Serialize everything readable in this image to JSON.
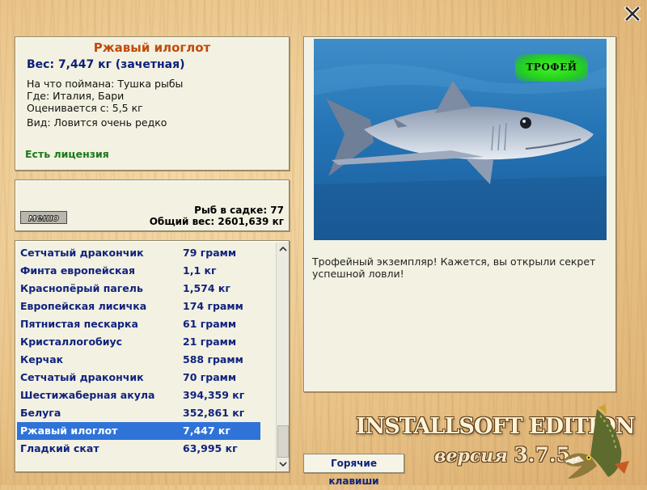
{
  "fish": {
    "name": "Ржавый илоглот",
    "weight": "Вес: 7,447 кг (зачетная)",
    "bait": "На что поймана: Тушка рыбы",
    "location": "Где: Италия, Бари",
    "value": "Оценивается с: 5,5 кг",
    "rarity": "Вид: Ловится очень редко",
    "license": "Есть лицензия"
  },
  "cage": {
    "menu_logo": "меню",
    "count": "Рыб в садке: 77",
    "total_weight": "Общий вес: 2601,639 кг"
  },
  "catch_list": [
    {
      "name": "Сетчатый дракончик",
      "weight": "79 грамм"
    },
    {
      "name": "Финта европейская",
      "weight": "1,1 кг"
    },
    {
      "name": "Краснопёрый пагель",
      "weight": "1,574 кг"
    },
    {
      "name": "Европейская лисичка",
      "weight": "174 грамм"
    },
    {
      "name": "Пятнистая пескарка",
      "weight": "61 грамм"
    },
    {
      "name": "Кристаллогобиус",
      "weight": "21 грамм"
    },
    {
      "name": "Керчак",
      "weight": "588 грамм"
    },
    {
      "name": "Сетчатый дракончик",
      "weight": "70 грамм"
    },
    {
      "name": "Шестижаберная акула",
      "weight": "394,359 кг"
    },
    {
      "name": "Белуга",
      "weight": "352,861 кг"
    },
    {
      "name": "Ржавый илоглот",
      "weight": "7,447 кг",
      "selected": true
    },
    {
      "name": "Гладкий скат",
      "weight": "63,995 кг"
    }
  ],
  "photo": {
    "badge": "ТРОФЕЙ",
    "message": "Трофейный экземпляр! Кажется, вы открыли секрет успешной ловли!"
  },
  "hotkeys_label": "Горячие клавиши",
  "branding": {
    "edition": "INSTALLSOFT EDITION",
    "version_label": "версия",
    "version_number": "3.7.5"
  },
  "icons": {
    "close": "close-icon",
    "scroll_up": "chevron-up-icon",
    "scroll_down": "chevron-down-icon",
    "mascot": "pike-fish-icon"
  },
  "colors": {
    "title": "#c04a0a",
    "list_text": "#10237e",
    "selection": "#2f73d8",
    "license": "#1a7a1a",
    "trophy": "#2bd81f"
  }
}
